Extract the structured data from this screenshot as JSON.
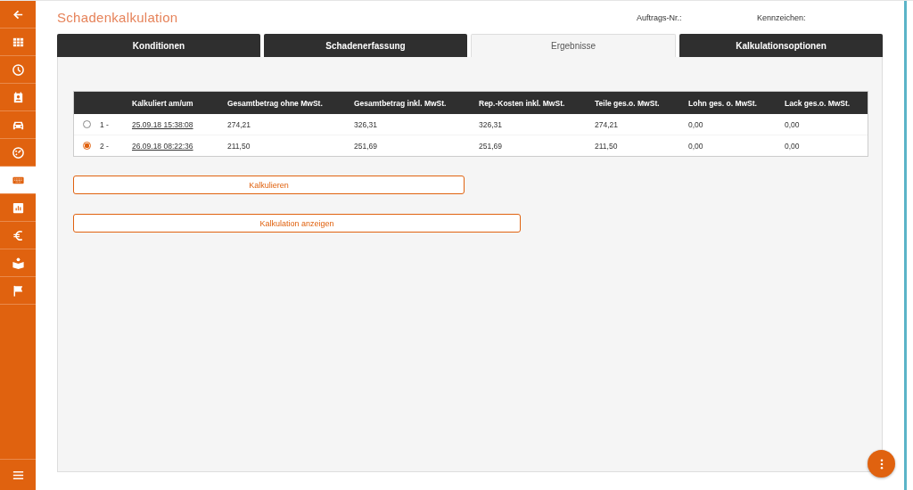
{
  "sidebar": {
    "items": [
      {
        "kind": "back",
        "selected": false
      },
      {
        "kind": "grid",
        "selected": false
      },
      {
        "kind": "clock",
        "selected": false
      },
      {
        "kind": "contact",
        "selected": false
      },
      {
        "kind": "car",
        "selected": false
      },
      {
        "kind": "gauge",
        "selected": false
      },
      {
        "kind": "keyboard",
        "selected": true
      },
      {
        "kind": "chart",
        "selected": false
      },
      {
        "kind": "euro",
        "selected": false
      },
      {
        "kind": "reader",
        "selected": false
      },
      {
        "kind": "flag",
        "selected": false
      }
    ],
    "bottom": {
      "kind": "menu"
    }
  },
  "header": {
    "title": "Schadenkalkulation",
    "fields": [
      "Auftrags-Nr.:",
      "Kennzeichen:"
    ]
  },
  "tabs": [
    {
      "label": "Konditionen",
      "selected": false
    },
    {
      "label": "Schadenerfassung",
      "selected": false
    },
    {
      "label": "Ergebnisse",
      "selected": true
    },
    {
      "label": "Kalkulationsoptionen",
      "selected": false
    }
  ],
  "table": {
    "columns": [
      "Kalkuliert am/um",
      "Gesamtbetrag ohne MwSt.",
      "Gesamtbetrag inkl. MwSt.",
      "Rep.-Kosten inkl. MwSt.",
      "Teile ges.o. MwSt.",
      "Lohn ges. o. MwSt.",
      "Lack ges.o. MwSt."
    ],
    "rows": [
      {
        "selected": false,
        "number": "1 -",
        "date": "25.09.18 15:38:08",
        "values": [
          "274,21",
          "326,31",
          "326,31",
          "274,21",
          "0,00",
          "0,00"
        ]
      },
      {
        "selected": true,
        "number": "2 -",
        "date": "26.09.18 08:22:36",
        "values": [
          "211,50",
          "251,69",
          "251,69",
          "211,50",
          "0,00",
          "0,00"
        ]
      }
    ]
  },
  "buttons": [
    "Kalkulieren",
    "Kalkulation anzeigen"
  ]
}
